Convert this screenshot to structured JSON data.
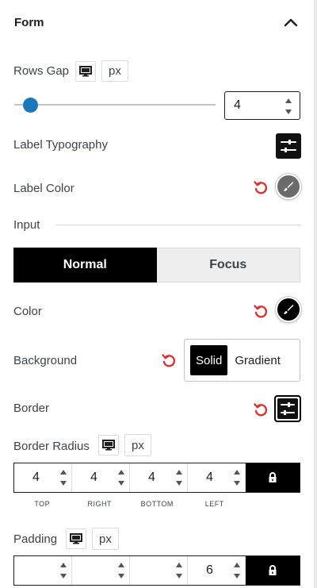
{
  "section": {
    "title": "Form"
  },
  "rows_gap": {
    "label": "Rows Gap",
    "unit": "px",
    "value": "4",
    "slider_fraction": 0.08
  },
  "label_typography": {
    "label": "Label Typography"
  },
  "label_color": {
    "label": "Label Color",
    "swatch_color": "#6b6b6b"
  },
  "input_heading": "Input",
  "state_tabs": {
    "normal": "Normal",
    "focus": "Focus",
    "active": "Normal"
  },
  "color": {
    "label": "Color",
    "swatch_color": "#000000"
  },
  "background": {
    "label": "Background",
    "solid": "Solid",
    "gradient": "Gradient",
    "active": "Solid"
  },
  "border": {
    "label": "Border"
  },
  "border_radius": {
    "label": "Border Radius",
    "unit": "px",
    "values": {
      "top": "4",
      "right": "4",
      "bottom": "4",
      "left": "4"
    },
    "sub_labels": {
      "top": "TOP",
      "right": "RIGHT",
      "bottom": "BOTTOM",
      "left": "LEFT"
    }
  },
  "padding": {
    "label": "Padding",
    "unit": "px",
    "values": {
      "top": "",
      "right": "",
      "bottom": "",
      "left": "6"
    }
  },
  "colors": {
    "accent": "#1c77b8",
    "reset": "#d63638",
    "active_bg": "#000000"
  },
  "icons": {
    "collapse": "chevron-up-icon",
    "device": "desktop-icon",
    "typography": "sliders-icon",
    "reset": "reset-icon",
    "color_picker": "brush-icon",
    "border": "sliders-icon",
    "lock": "lock-icon"
  }
}
